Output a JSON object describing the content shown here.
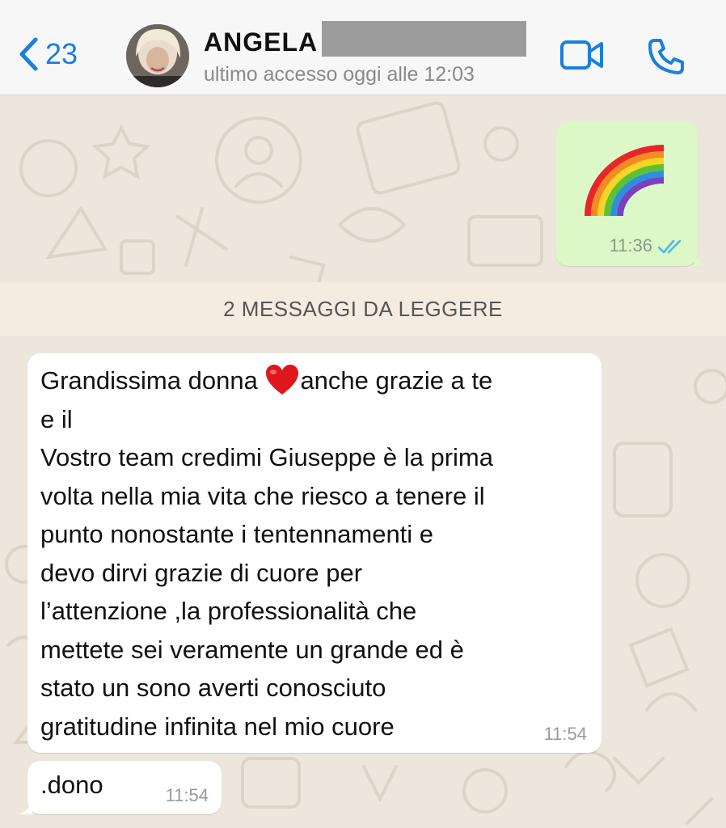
{
  "header": {
    "back_count": "23",
    "contact_name": "ANGELA",
    "last_seen": "ultimo accesso oggi alle 12:03",
    "icons": [
      "chevron-left-icon",
      "video-call-icon",
      "phone-icon"
    ],
    "accent_color": "#1a7fe0"
  },
  "outgoing": {
    "content_icon": "rainbow-emoji",
    "time": "11:36",
    "status_icon": "double-check-read-icon"
  },
  "unread_banner": "2 MESSAGGI DA LEGGERE",
  "incoming": [
    {
      "text_before_heart": "Grandissima donna ",
      "text_after_heart": "anche grazie a te\ne il\nVostro team credimi Giuseppe è la prima\nvolta nella mia vita che riesco a tenere il\npunto nonostante i tentennamenti e\ndevo dirvi grazie di cuore per\nl’attenzione ,la professionalità che\nmettete sei veramente un grande ed è\nstato un sono averti conosciuto\ngratitudine infinita nel mio cuore",
      "inline_icon": "red-heart-emoji",
      "time": "11:54"
    },
    {
      "text": ".dono",
      "time": "11:54"
    }
  ]
}
